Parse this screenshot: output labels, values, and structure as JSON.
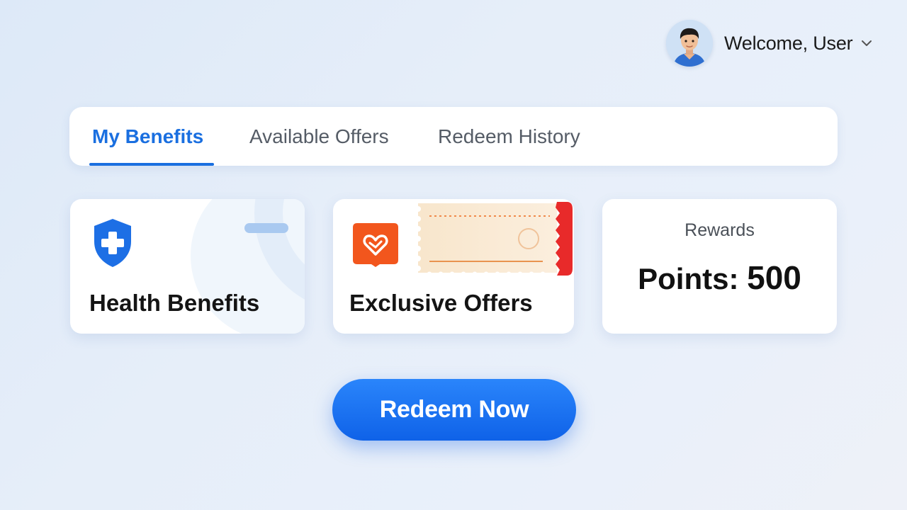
{
  "user": {
    "welcome_text": "Welcome, User",
    "avatar_icon": "user-avatar-icon",
    "menu_icon": "chevron-down-icon"
  },
  "tabs": [
    {
      "label": "My Benefits",
      "active": true
    },
    {
      "label": "Available Offers",
      "active": false
    },
    {
      "label": "Redeem History",
      "active": false
    }
  ],
  "cards": {
    "health": {
      "title": "Health Benefits",
      "icon": "shield-plus-icon"
    },
    "offers": {
      "title": "Exclusive Offers",
      "icon": "offer-badge-icon",
      "decor_icon": "ticket-icon"
    },
    "rewards": {
      "label": "Rewards",
      "points_prefix": "Points: ",
      "points_value": "500"
    }
  },
  "actions": {
    "redeem_label": "Redeem Now"
  },
  "colors": {
    "accent": "#1a6fe0",
    "button": "#1568ee",
    "offer_orange": "#f2561d",
    "ticket_red": "#e82a2a",
    "background": "#e6eef9"
  }
}
